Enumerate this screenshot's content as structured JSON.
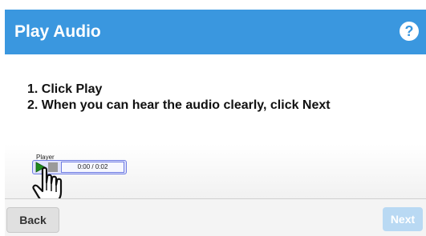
{
  "header": {
    "title": "Play Audio",
    "help_label": "?"
  },
  "instructions": {
    "step1": "1. Click Play",
    "step2": "2. When you can hear the audio clearly, click Next"
  },
  "player": {
    "label": "Player",
    "time": "0:00 / 0:02"
  },
  "footer": {
    "back_label": "Back",
    "next_label": "Next"
  },
  "colors": {
    "header_bg": "#3a97df",
    "play_green": "#1f8a1f",
    "next_disabled": "#b9d9f3"
  }
}
